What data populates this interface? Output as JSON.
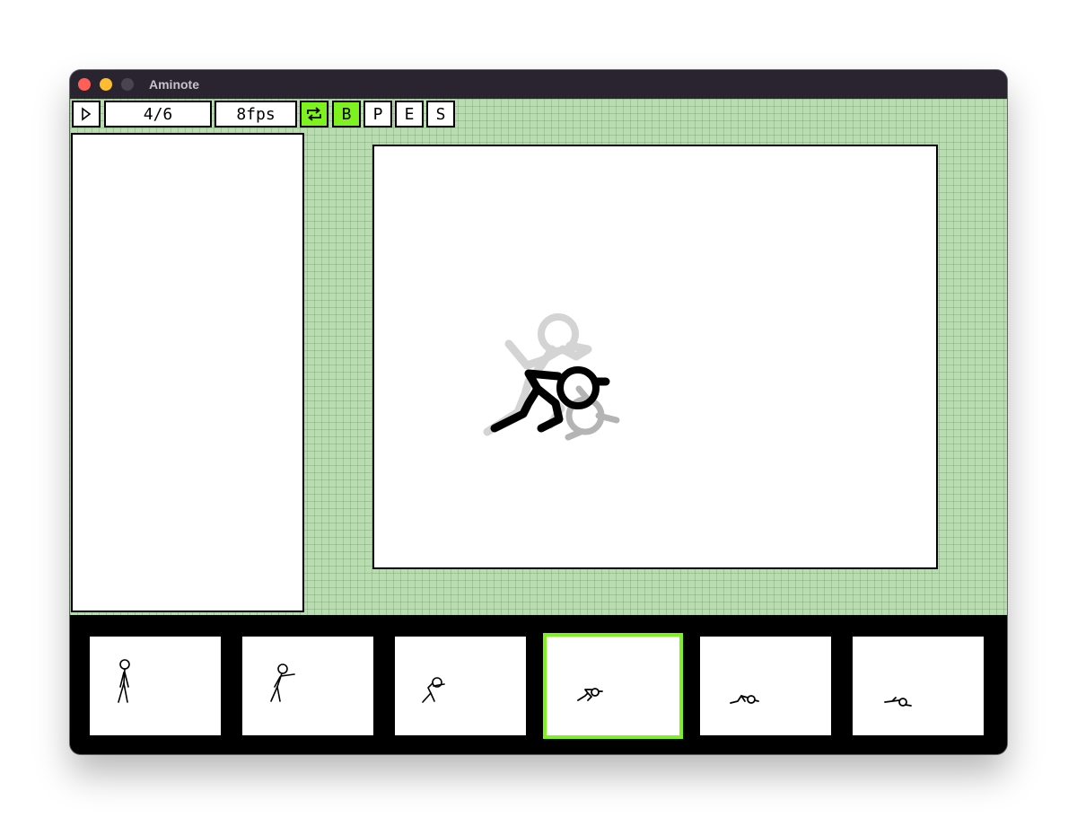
{
  "app": {
    "title": "Aminote"
  },
  "toolbar": {
    "play_icon": "play-icon",
    "frame_counter": "4/6",
    "fps": "8fps",
    "loop_icon": "loop-icon",
    "loop_active": true,
    "b_label": "B",
    "b_active": true,
    "p_label": "P",
    "e_label": "E",
    "s_label": "S"
  },
  "timeline": {
    "current_frame": 4,
    "total_frames": 6,
    "frames": [
      {
        "index": 1,
        "selected": false
      },
      {
        "index": 2,
        "selected": false
      },
      {
        "index": 3,
        "selected": false
      },
      {
        "index": 4,
        "selected": true
      },
      {
        "index": 5,
        "selected": false
      },
      {
        "index": 6,
        "selected": false
      }
    ]
  },
  "colors": {
    "accent": "#7df21e",
    "workspace": "#b9dcb0",
    "titlebar": "#2a2330",
    "onion_skin": "#c8c8c8"
  }
}
